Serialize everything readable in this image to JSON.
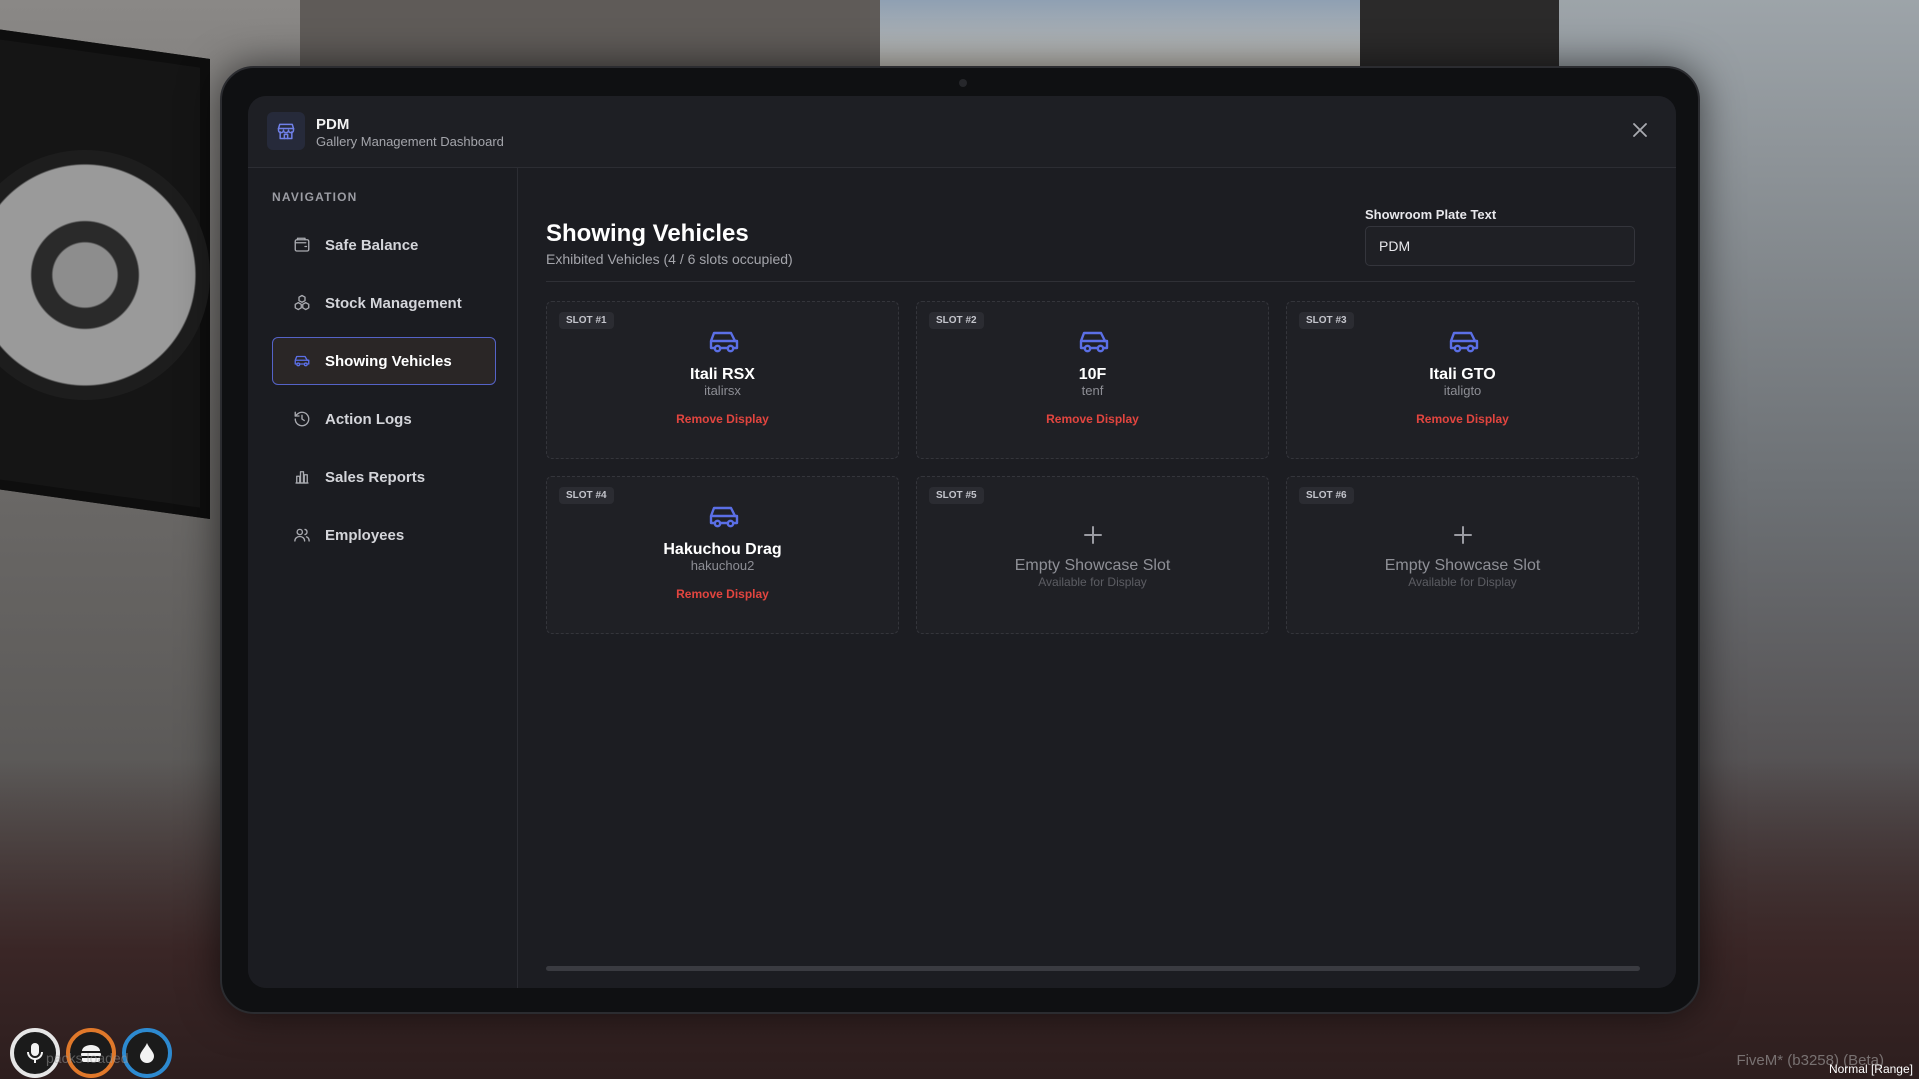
{
  "app": {
    "title": "PDM",
    "subtitle": "Gallery Management Dashboard"
  },
  "sidebar": {
    "heading": "NAVIGATION",
    "items": [
      {
        "label": "Safe Balance",
        "icon": "wallet-icon",
        "active": false
      },
      {
        "label": "Stock Management",
        "icon": "boxes-icon",
        "active": false
      },
      {
        "label": "Showing Vehicles",
        "icon": "car-icon",
        "active": true
      },
      {
        "label": "Action Logs",
        "icon": "history-icon",
        "active": false
      },
      {
        "label": "Sales Reports",
        "icon": "bar-chart-icon",
        "active": false
      },
      {
        "label": "Employees",
        "icon": "users-icon",
        "active": false
      }
    ]
  },
  "main": {
    "title": "Showing Vehicles",
    "subtitle": "Exhibited Vehicles (4 / 6 slots occupied)",
    "plate_label": "Showroom Plate Text",
    "plate_value": "PDM",
    "slots": [
      {
        "badge": "SLOT #1",
        "name": "Itali RSX",
        "model": "italirsx",
        "action": "Remove Display"
      },
      {
        "badge": "SLOT #2",
        "name": "10F",
        "model": "tenf",
        "action": "Remove Display"
      },
      {
        "badge": "SLOT #3",
        "name": "Itali GTO",
        "model": "italigto",
        "action": "Remove Display"
      },
      {
        "badge": "SLOT #4",
        "name": "Hakuchou Drag",
        "model": "hakuchou2",
        "action": "Remove Display"
      },
      {
        "badge": "SLOT #5",
        "empty_title": "Empty Showcase Slot",
        "empty_sub": "Available for Display"
      },
      {
        "badge": "SLOT #6",
        "empty_title": "Empty Showcase Slot",
        "empty_sub": "Available for Display"
      }
    ]
  },
  "hud": {
    "overlay_text": "packs loaded",
    "client_tag": "FiveM* (b3258) (Beta)",
    "voice_range": "Normal [Range]"
  },
  "colors": {
    "accent": "#5563c8",
    "car_icon": "#5b6fe6",
    "danger": "#e2453f",
    "panel": "#1c1d22"
  }
}
